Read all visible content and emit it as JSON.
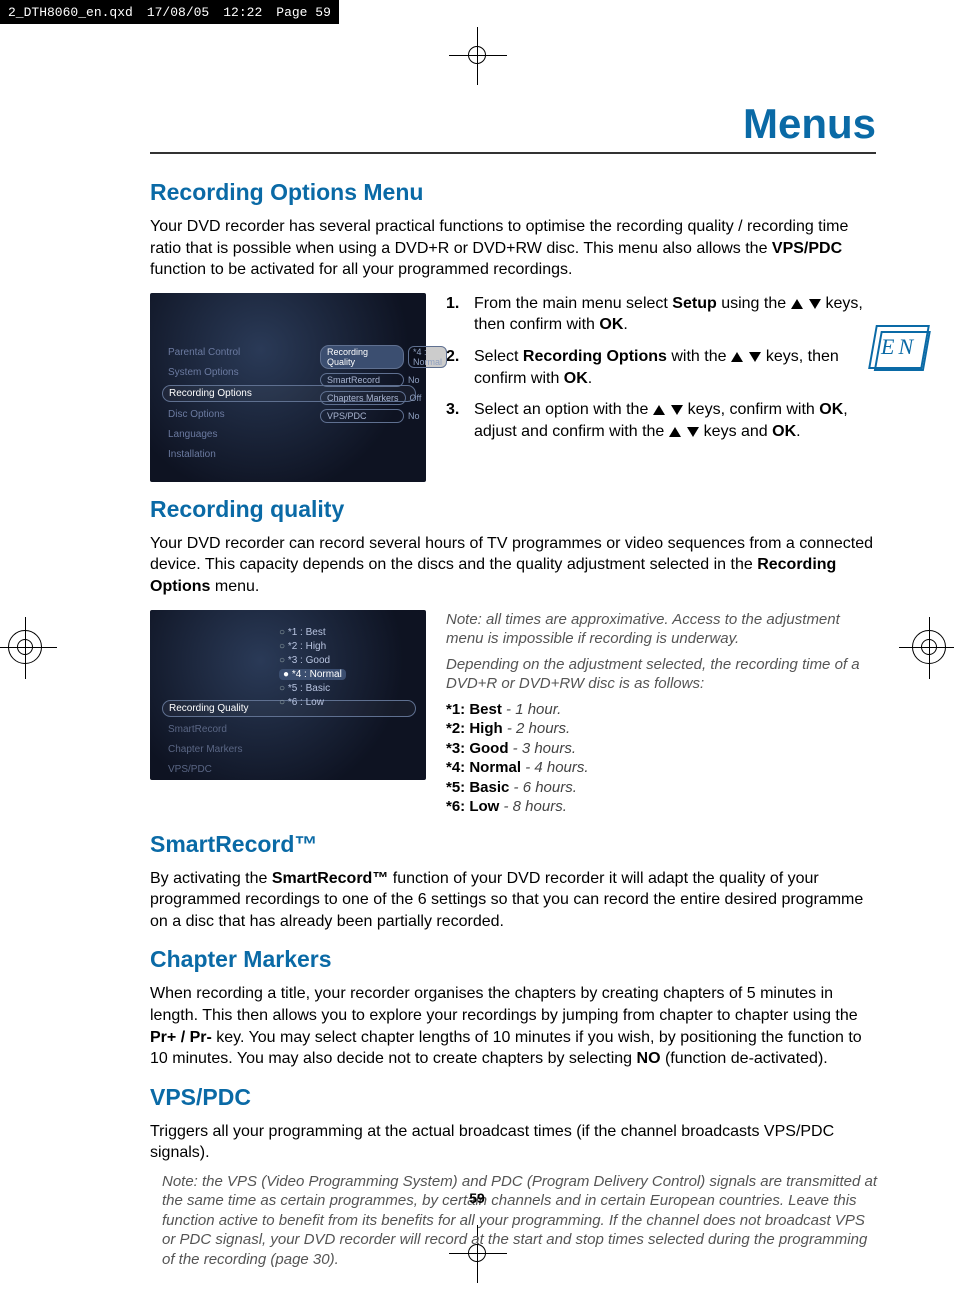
{
  "header_strip": {
    "filename": "2_DTH8060_en.qxd",
    "date": "17/08/05",
    "time": "12:22",
    "page_label": "Page 59"
  },
  "page_title": "Menus",
  "lang_tab": "EN",
  "page_number": "59",
  "section1": {
    "heading": "Recording Options Menu",
    "intro_pre": "Your DVD recorder has several practical functions to optimise the recording quality / recording time ratio that is possible when using a DVD+R or DVD+RW disc. This menu also allows the ",
    "intro_bold": "VPS/PDC",
    "intro_post": " function to be activated for all your programmed recordings.",
    "thumb_menu": {
      "items": [
        "Parental Control",
        "System Options",
        "Recording Options",
        "Disc Options",
        "Languages",
        "Installation"
      ],
      "selected_index": 2,
      "sub": [
        {
          "label": "Recording Quality",
          "value": "*4 : Normal",
          "selected": true
        },
        {
          "label": "SmartRecord",
          "value": "No"
        },
        {
          "label": "Chapters Markers",
          "value": "Off"
        },
        {
          "label": "VPS/PDC",
          "value": "No"
        }
      ]
    },
    "steps": [
      {
        "n": "1.",
        "pre": "From the main menu select ",
        "b1": "Setup",
        "mid": " using the ",
        "post": " keys, then confirm with ",
        "b2": "OK",
        "tail": "."
      },
      {
        "n": "2.",
        "pre": "Select ",
        "b1": "Recording Options",
        "mid": " with the ",
        "post": " keys, then confirm with ",
        "b2": "OK",
        "tail": "."
      },
      {
        "n": "3.",
        "pre": "Select an option with the ",
        "mid_arrows": true,
        "mid2": " keys, confirm with ",
        "b1": "OK",
        "mid3": ", adjust and confirm with the ",
        "post": " keys and ",
        "b2": "OK",
        "tail": "."
      }
    ]
  },
  "section2": {
    "heading": "Recording quality",
    "intro_pre": "Your DVD recorder can record several hours of TV programmes or video sequences from a connected device. This capacity depends on the discs and the quality adjustment selected in the ",
    "intro_bold": "Recording Options",
    "intro_post": " menu.",
    "thumb": {
      "left_items": [
        "Recording Quality",
        "SmartRecord",
        "Chapter Markers",
        "VPS/PDC"
      ],
      "left_selected_index": 0,
      "options": [
        "*1 : Best",
        "*2 : High",
        "*3 : Good",
        "*4 : Normal",
        "*5 : Basic",
        "*6 : Low"
      ],
      "options_selected_index": 3
    },
    "note1": "Note: all times are approximative. Access to the adjustment menu is impossible if recording is underway.",
    "note2": "Depending on the adjustment selected, the recording time of a DVD+R or DVD+RW disc is as follows:",
    "quality_levels": [
      {
        "b": "*1: Best",
        "t": " - 1 hour."
      },
      {
        "b": "*2: High",
        "t": " - 2 hours."
      },
      {
        "b": "*3: Good",
        "t": " - 3 hours."
      },
      {
        "b": "*4: Normal",
        "t": " - 4 hours."
      },
      {
        "b": "*5: Basic",
        "t": " - 6 hours."
      },
      {
        "b": "*6: Low",
        "t": " - 8 hours."
      }
    ]
  },
  "section3": {
    "heading": "SmartRecord™",
    "text_pre": "By activating the ",
    "bold": "SmartRecord™",
    "text_post": " function of your DVD recorder it will adapt the quality of your programmed recordings to one of the 6 settings so that you can record the entire desired programme on a disc that has already been partially recorded."
  },
  "section4": {
    "heading": "Chapter Markers",
    "text_pre": "When recording a title, your recorder organises the chapters by creating chapters of 5 minutes in length. This then allows you to explore your recordings by jumping from chapter to chapter using the ",
    "bold1": "Pr+ / Pr-",
    "mid": " key. You may select chapter lengths of 10 minutes if you wish, by positioning the function to 10 minutes. You may also decide not to create chapters by selecting ",
    "bold2": "NO",
    "text_post": " (function de-activated)."
  },
  "section5": {
    "heading": "VPS/PDC",
    "text": "Triggers all your programming at the actual broadcast times (if the channel broadcasts VPS/PDC signals).",
    "note": "Note:  the VPS (Video Programming System) and PDC (Program Delivery Control) signals are transmitted at the same time as certain programmes, by certain channels and in certain European countries. Leave this function active to benefit from its benefits for all your programming. If the channel does not broadcast VPS or PDC signasl, your DVD recorder will record at the start and stop times selected during the programming of the recording (page 30)."
  }
}
